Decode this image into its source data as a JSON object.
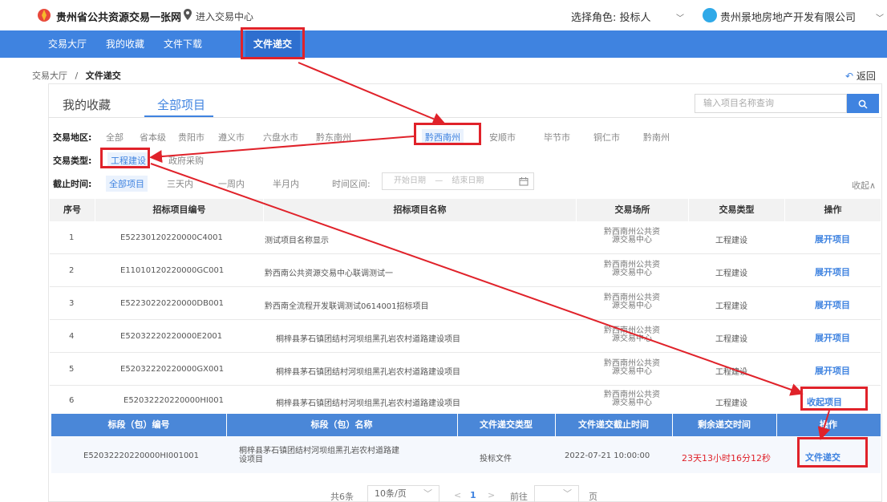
{
  "header": {
    "site_title": "贵州省公共资源交易一张网",
    "enter_link": "进入交易中心",
    "role_label": "选择角色: 投标人",
    "company": "贵州景地房地产开发有限公司"
  },
  "nav": {
    "items": [
      "交易大厅",
      "我的收藏",
      "文件下载",
      "文件递交"
    ],
    "active_index": 3
  },
  "breadcrumb": {
    "root": "交易大厅",
    "sep": "/",
    "current": "文件递交"
  },
  "back_label": "返回",
  "tabs": [
    "我的收藏",
    "全部项目"
  ],
  "search": {
    "placeholder": "输入项目名称查询",
    "icon": "search-icon"
  },
  "filters": {
    "region_label": "交易地区:",
    "regions": [
      "全部",
      "省本级",
      "贵阳市",
      "遵义市",
      "六盘水市",
      "黔东南州",
      "黔西南州",
      "安顺市",
      "毕节市",
      "铜仁市",
      "黔南州"
    ],
    "region_selected": "黔西南州",
    "type_label": "交易类型:",
    "types": [
      "工程建设",
      "政府采购"
    ],
    "type_selected": "工程建设",
    "deadline_label": "截止时间:",
    "deadlines": [
      "全部项目",
      "三天内",
      "一周内",
      "半月内"
    ],
    "deadline_selected": "全部项目",
    "range_label": "时间区间:",
    "date_range": {
      "start": "开始日期",
      "sep": "—",
      "end": "结束日期"
    },
    "collapse_label": "收起"
  },
  "table": {
    "columns": [
      "序号",
      "招标项目编号",
      "招标项目名称",
      "交易场所",
      "交易类型",
      "操作"
    ],
    "rows": [
      {
        "no": "1",
        "code": "E52230120220000C4001",
        "name": "测试项目名称显示",
        "venue": [
          "黔西南州公共资",
          "源交易中心"
        ],
        "type": "工程建设",
        "action": "展开项目"
      },
      {
        "no": "2",
        "code": "E11010120220000GC001",
        "name": "黔西南公共资源交易中心联调测试一",
        "venue": [
          "黔西南州公共资",
          "源交易中心"
        ],
        "type": "工程建设",
        "action": "展开项目"
      },
      {
        "no": "3",
        "code": "E52230220220000DB001",
        "name": "黔西南全流程开发联调测试0614001招标项目",
        "venue": [
          "黔西南州公共资",
          "源交易中心"
        ],
        "type": "工程建设",
        "action": "展开项目"
      },
      {
        "no": "4",
        "code": "E52032220220000E2001",
        "name": "桐梓县茅石镇团结村河坝组黑孔岩农村道路建设项目",
        "venue": [
          "黔西南州公共资",
          "源交易中心"
        ],
        "type": "工程建设",
        "action": "展开项目"
      },
      {
        "no": "5",
        "code": "E52032220220000GX001",
        "name": "桐梓县茅石镇团结村河坝组黑孔岩农村道路建设项目",
        "venue": [
          "黔西南州公共资",
          "源交易中心"
        ],
        "type": "工程建设",
        "action": "展开项目"
      },
      {
        "no": "6",
        "code": "E52032220220000HI001",
        "name": "桐梓县茅石镇团结村河坝组黑孔岩农村道路建设项目",
        "venue": [
          "黔西南州公共资",
          "源交易中心"
        ],
        "type": "工程建设",
        "action": "收起项目"
      }
    ]
  },
  "subtable": {
    "columns": [
      "标段（包）编号",
      "标段（包）名称",
      "文件递交类型",
      "文件递交截止时间",
      "剩余递交时间",
      "操作"
    ],
    "row": {
      "code": "E52032220220000HI001001",
      "name": [
        "桐梓县茅石镇团结村河坝组黑孔岩农村道路建",
        "设项目"
      ],
      "file_type": "投标文件",
      "deadline": "2022-07-21 10:00:00",
      "remaining": "23天13小时16分12秒",
      "action": "文件递交"
    }
  },
  "pagination": {
    "total": "共6条",
    "page_size": "10条/页",
    "prev": "<",
    "current": "1",
    "next": ">",
    "goto_label": "前往",
    "page_unit": "页"
  },
  "colors": {
    "brand_blue": "#3f83e0",
    "highlight_red": "#e0222a",
    "countdown_red": "#e0222a"
  }
}
